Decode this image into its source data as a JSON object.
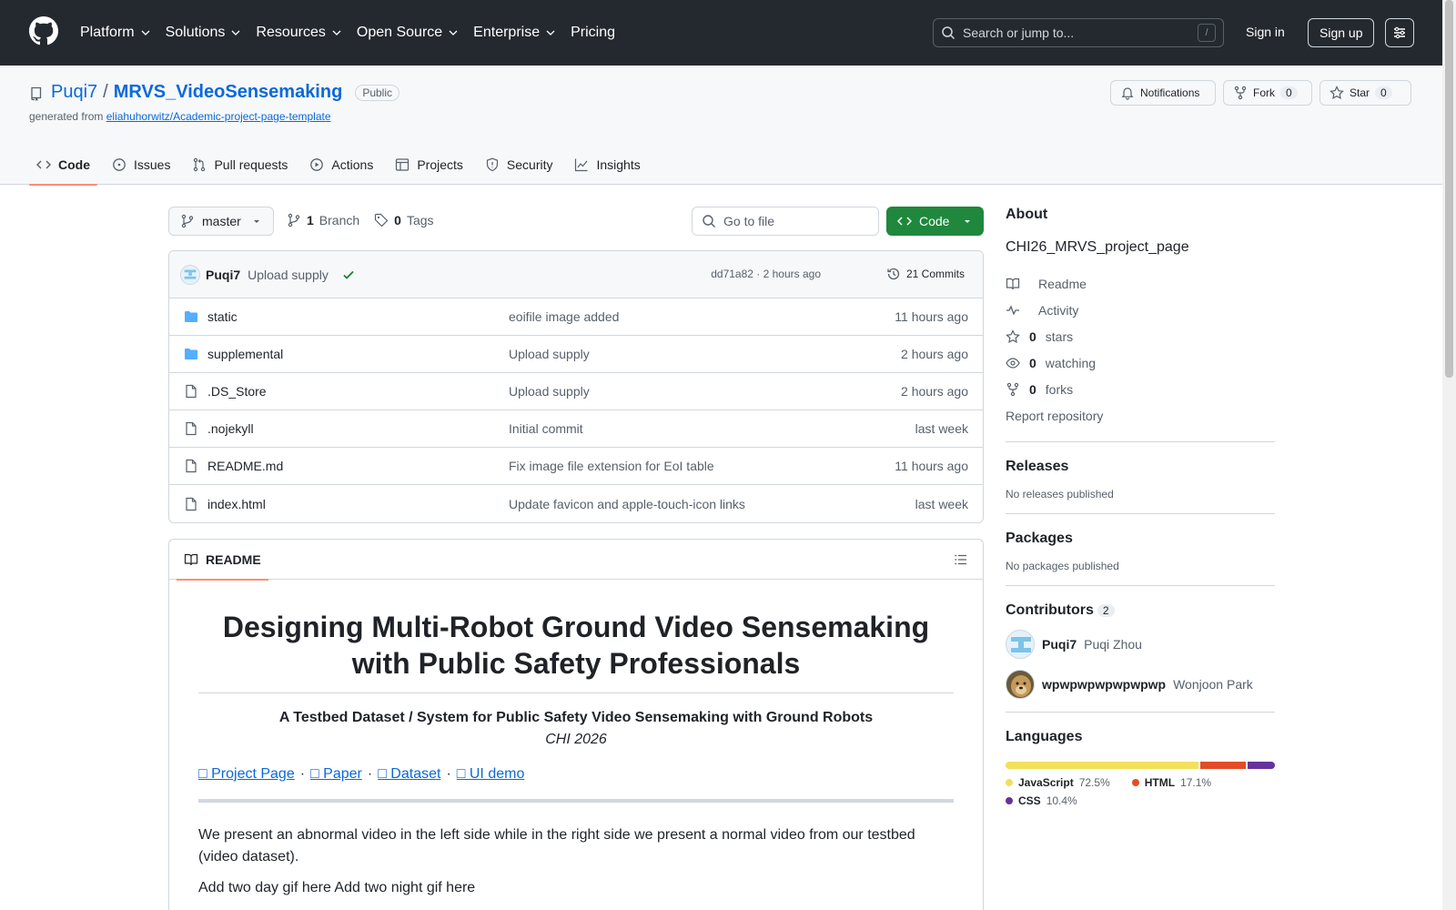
{
  "header": {
    "nav": [
      "Platform",
      "Solutions",
      "Resources",
      "Open Source",
      "Enterprise",
      "Pricing"
    ],
    "search_placeholder": "Search or jump to...",
    "search_shortcut": "/",
    "signin": "Sign in",
    "signup": "Sign up"
  },
  "repo": {
    "owner": "Puqi7",
    "separator": "/",
    "name": "MRVS_VideoSensemaking",
    "visibility": "Public",
    "generated_prefix": "generated from",
    "generated_from": "eliahuhorwitz/Academic-project-page-template",
    "notifications": "Notifications",
    "fork": "Fork",
    "fork_count": "0",
    "star": "Star",
    "star_count": "0"
  },
  "tabs": [
    "Code",
    "Issues",
    "Pull requests",
    "Actions",
    "Projects",
    "Security",
    "Insights"
  ],
  "toolbar": {
    "branch": "master",
    "branch_count": "1",
    "branch_label": "Branch",
    "tag_count": "0",
    "tag_label": "Tags",
    "goto_placeholder": "Go to file",
    "code_button": "Code"
  },
  "commit": {
    "author": "Puqi7",
    "message": "Upload supply",
    "hash_time": "dd71a82 · 2 hours ago",
    "commits": "21 Commits"
  },
  "files": [
    {
      "name": "static",
      "type": "dir",
      "message": "eoifile image added",
      "time": "11 hours ago"
    },
    {
      "name": "supplemental",
      "type": "dir",
      "message": "Upload supply",
      "time": "2 hours ago"
    },
    {
      "name": ".DS_Store",
      "type": "file",
      "message": "Upload supply",
      "time": "2 hours ago"
    },
    {
      "name": ".nojekyll",
      "type": "file",
      "message": "Initial commit",
      "time": "last week"
    },
    {
      "name": "README.md",
      "type": "file",
      "message": "Fix image file extension for EoI table",
      "time": "11 hours ago"
    },
    {
      "name": "index.html",
      "type": "file",
      "message": "Update favicon and apple-touch-icon links",
      "time": "last week"
    }
  ],
  "readme": {
    "tab": "README",
    "title": "Designing Multi-Robot Ground Video Sensemaking with Public Safety Professionals",
    "subtitle": "A Testbed Dataset / System for Public Safety Video Sensemaking with Ground Robots",
    "venue": "CHI 2026",
    "links": [
      "□ Project Page",
      "□ Paper",
      "□ Dataset",
      "□ UI demo"
    ],
    "link_sep": "·",
    "paragraph": "We present an abnormal video in the left side while in the right side we present a normal video from our testbed (video dataset).",
    "paragraph2": "Add two day gif here Add two night gif here"
  },
  "sidebar": {
    "about_title": "About",
    "description": "CHI26_MRVS_project_page",
    "items": [
      {
        "icon": "book-icon",
        "count": "",
        "label": "Readme"
      },
      {
        "icon": "pulse-icon",
        "count": "",
        "label": "Activity"
      },
      {
        "icon": "star-icon",
        "count": "0",
        "label": "stars"
      },
      {
        "icon": "eye-icon",
        "count": "0",
        "label": "watching"
      },
      {
        "icon": "fork-icon",
        "count": "0",
        "label": "forks"
      }
    ],
    "report": "Report repository",
    "releases_title": "Releases",
    "releases_note": "No releases published",
    "packages_title": "Packages",
    "packages_note": "No packages published",
    "contributors_title": "Contributors",
    "contributors_count": "2",
    "contributors": [
      {
        "login": "Puqi7",
        "name": "Puqi Zhou"
      },
      {
        "login": "wpwpwpwpwpwpwp",
        "name": "Wonjoon Park"
      }
    ],
    "languages_title": "Languages",
    "languages": [
      {
        "name": "JavaScript",
        "percent": "72.5%",
        "value": 72.5,
        "color": "#f1e05a"
      },
      {
        "name": "HTML",
        "percent": "17.1%",
        "value": 17.1,
        "color": "#e34c26"
      },
      {
        "name": "CSS",
        "percent": "10.4%",
        "value": 10.4,
        "color": "#663399"
      }
    ]
  }
}
